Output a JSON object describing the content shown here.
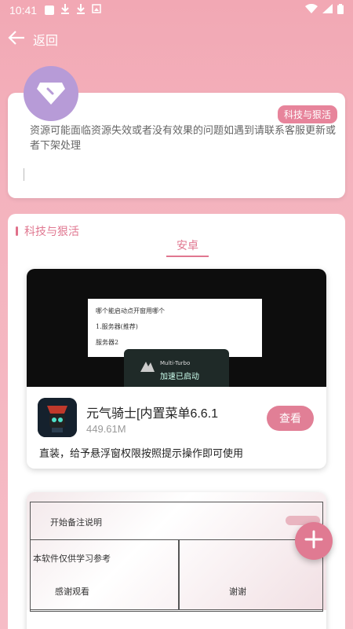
{
  "status": {
    "time": "10:41"
  },
  "header": {
    "back_label": "返回"
  },
  "info": {
    "tag": "科技与狠活",
    "notice": "资源可能面临资源失效或者没有效果的问题如遇到请联系客服更新或者下架处理"
  },
  "section": {
    "title": "科技与狠活",
    "tab": "安卓"
  },
  "apps": [
    {
      "name": "元气骑士[内置菜单6.6.1",
      "size": "449.61M",
      "button": "查看",
      "description": "直装，给予悬浮窗权限按照提示操作即可使用",
      "preview": {
        "dialog_line1": "哪个能启动点开窗用哪个",
        "dialog_line2": "1.服务器(推荐)",
        "dialog_line3": "服务器2",
        "turbo_name": "Multi-Turbo",
        "turbo_status": "加速已启动"
      }
    },
    {
      "preview": {
        "note1": "开始备注说明",
        "note2": "本软件仅供学习参考",
        "note3": "感谢观看",
        "note4": "谢谢"
      }
    }
  ],
  "colors": {
    "accent": "#e07a92",
    "tag": "#e7849b",
    "avatar": "#b79bd7"
  },
  "icons": [
    "back-arrow-icon",
    "diamond-icon",
    "plus-icon",
    "wifi-icon",
    "signal-icon",
    "battery-icon",
    "download-icon"
  ]
}
